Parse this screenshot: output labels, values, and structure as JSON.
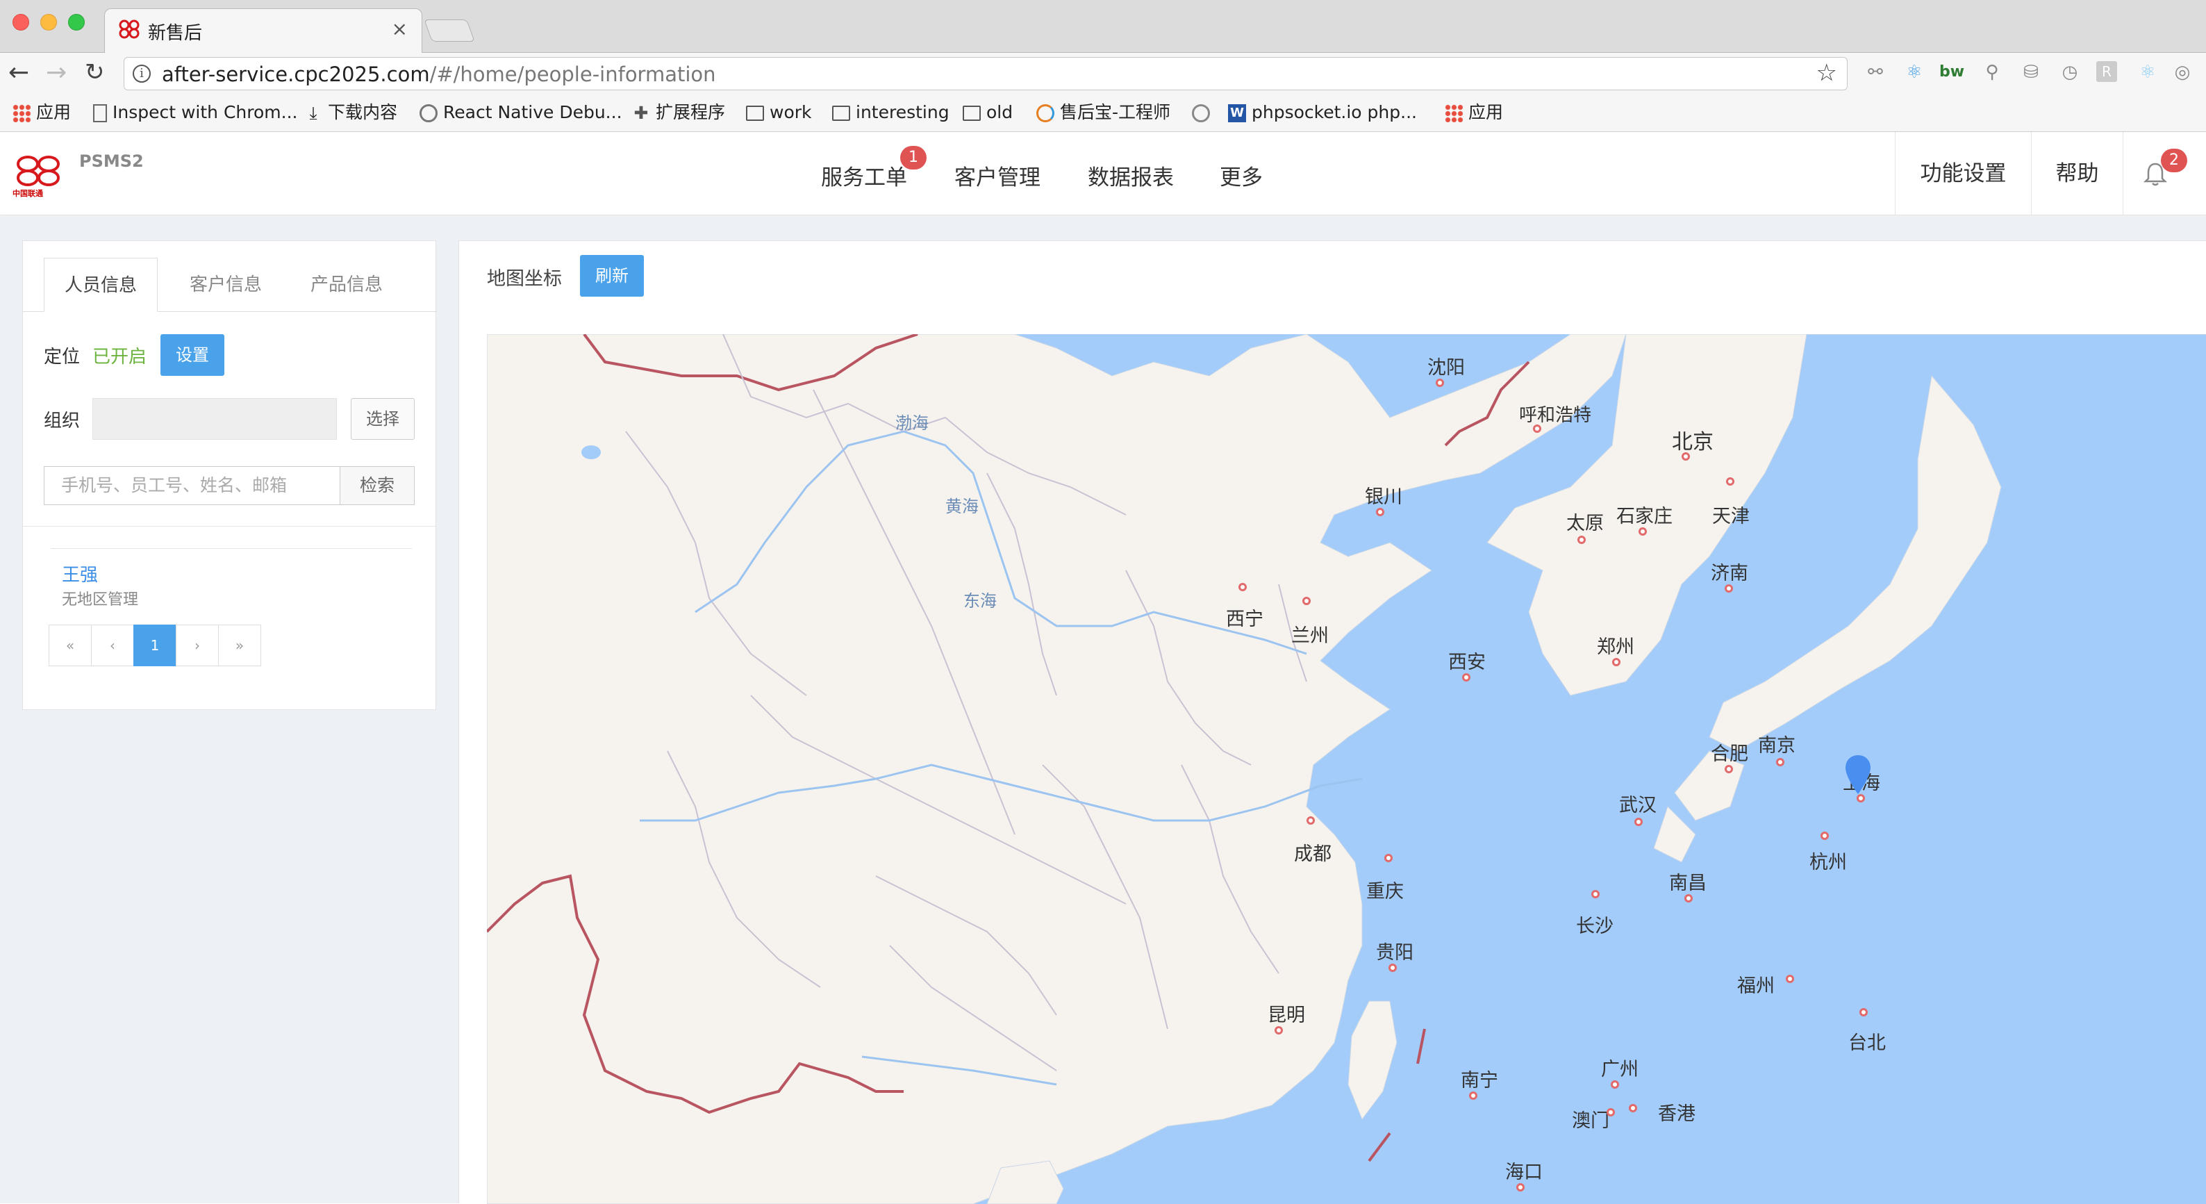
{
  "browser": {
    "tab_title": "新售后",
    "url_main": "after-service.cpc2025.com",
    "url_path": "/#/home/people-information",
    "bookmarks": [
      "应用",
      "Inspect with Chrom...",
      "下载内容",
      "React Native Debu...",
      "扩展程序",
      "work",
      "interesting",
      "old",
      "售后宝-工程师",
      "phpsocket.io php...",
      "应用"
    ]
  },
  "header": {
    "logo_sub": "中国联通",
    "app_name": "PSMS2",
    "nav": [
      "服务工单",
      "客户管理",
      "数据报表",
      "更多"
    ],
    "nav_badge": "1",
    "right_nav": [
      "功能设置",
      "帮助"
    ],
    "bell_badge": "2"
  },
  "left": {
    "tabs": [
      "人员信息",
      "客户信息",
      "产品信息"
    ],
    "location_label": "定位",
    "location_status": "已开启",
    "set_button": "设置",
    "org_label": "组织",
    "pick_button": "选择",
    "search_placeholder": "手机号、员工号、姓名、邮箱",
    "search_button": "检索",
    "person": {
      "name": "王强",
      "sub": "无地区管理"
    },
    "pager": [
      "«",
      "‹",
      "1",
      "›",
      "»"
    ]
  },
  "right": {
    "title": "地图坐标",
    "refresh_button": "刷新"
  },
  "map": {
    "land_color": "#f6f3ee",
    "sea_color": "#a3ccfa",
    "border_color": "#b85561",
    "province_color": "#c9c2d3",
    "cities": [
      "沈阳",
      "呼和浩特",
      "北京",
      "银川",
      "天津",
      "太原",
      "石家庄",
      "济南",
      "西宁",
      "兰州",
      "郑州",
      "西安",
      "合肥",
      "南京",
      "上海",
      "武汉",
      "成都",
      "重庆",
      "杭州",
      "南昌",
      "长沙",
      "贵阳",
      "福州",
      "昆明",
      "台北",
      "广州",
      "南宁",
      "澳门",
      "香港",
      "海口"
    ],
    "seas": [
      "渤海",
      "黄海",
      "东海"
    ]
  },
  "icons": [
    "back-icon",
    "forward-icon",
    "reload-icon",
    "info-icon",
    "star-icon",
    "bell-icon",
    "map-marker-icon"
  ]
}
